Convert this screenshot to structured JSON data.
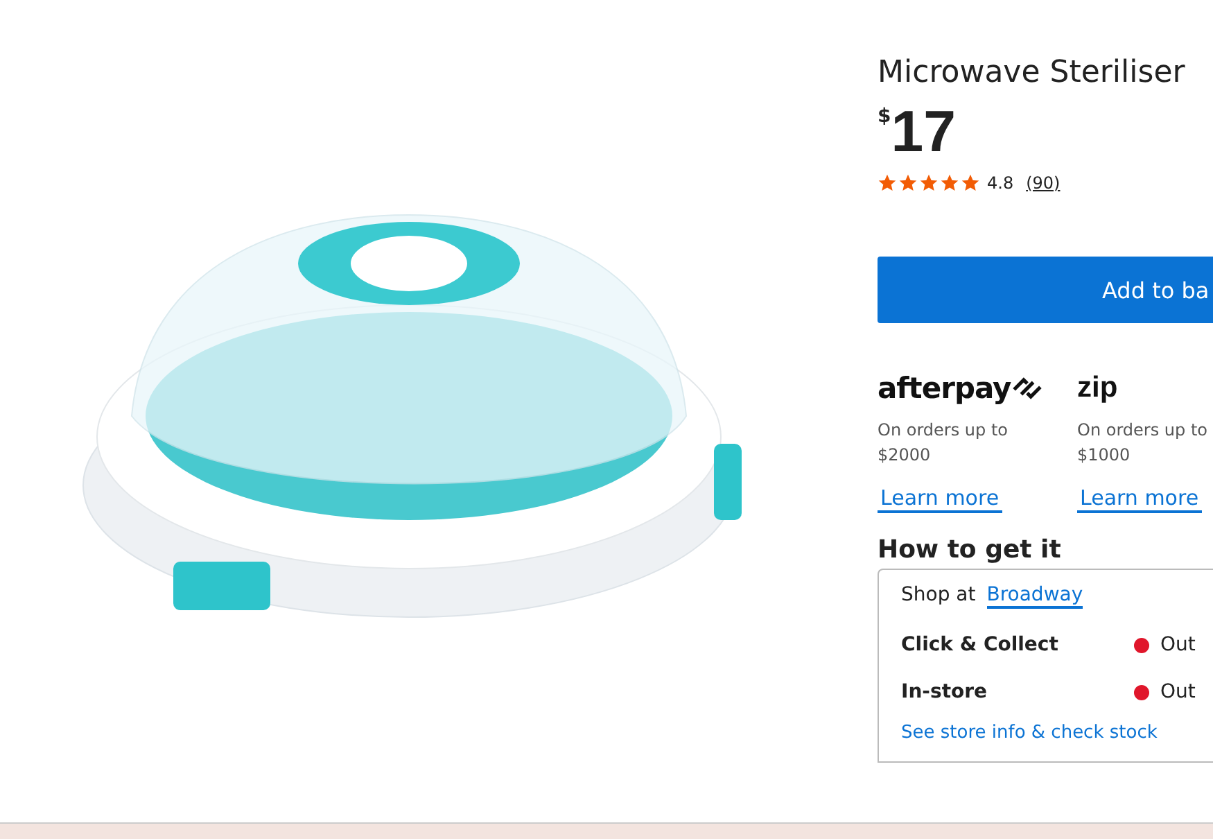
{
  "product": {
    "title": "Microwave Steriliser",
    "currency": "$",
    "price": "17",
    "stars": 5,
    "rating": "4.8",
    "reviews": "(90)"
  },
  "add_button": "Add to ba",
  "payments": [
    {
      "kind": "afterpay",
      "logo": "afterpay",
      "note": "On orders up to $2000",
      "link": "Learn more"
    },
    {
      "kind": "zip",
      "logo": "zip",
      "note": "On orders up to $1000",
      "link": "Learn more"
    }
  ],
  "delivery": {
    "heading": "How to get it",
    "shop_label": "Shop at",
    "store": "Broadway",
    "options": [
      {
        "name": "Click & Collect",
        "status": "Out",
        "color": "#e0162b"
      },
      {
        "name": "In-store",
        "status": "Out",
        "color": "#e0162b"
      }
    ],
    "link": "See store info & check stock"
  }
}
